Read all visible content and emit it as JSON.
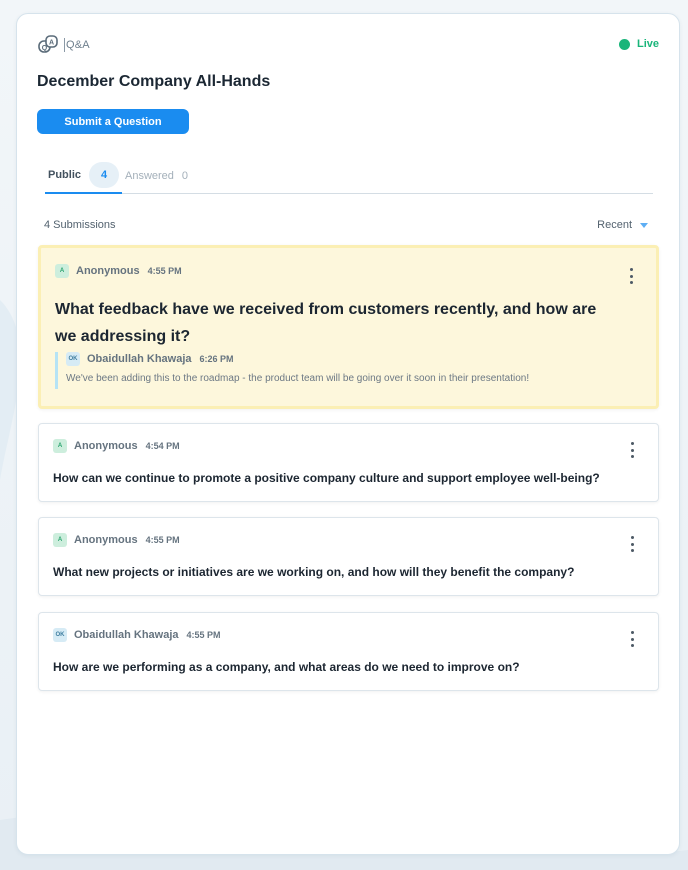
{
  "header": {
    "brand_label": "Q&A",
    "brand_icon": "qa-bubbles-icon",
    "live_label": "Live",
    "live_color": "#19b57a"
  },
  "event": {
    "title": "December Company All-Hands"
  },
  "actions": {
    "submit_label": "Submit a Question"
  },
  "tabs": [
    {
      "label": "Public",
      "count": "4",
      "active": true
    },
    {
      "label": "Answered",
      "count": "0",
      "active": false
    }
  ],
  "list": {
    "submissions_label": "4 Submissions",
    "sort_label": "Recent"
  },
  "questions": [
    {
      "author": "Anonymous",
      "initials": "A",
      "time": "4:55 PM",
      "text": "What feedback have we received from customers recently, and how are we addressing it?",
      "highlighted": true,
      "reply": {
        "author": "Obaidullah Khawaja",
        "initials": "OK",
        "time": "6:26 PM",
        "text": "We've been adding this to the roadmap - the product team will be going over it soon in their presentation!"
      }
    },
    {
      "author": "Anonymous",
      "initials": "A",
      "time": "4:54 PM",
      "text": "How can we continue to promote a positive company culture and support employee well-being?"
    },
    {
      "author": "Anonymous",
      "initials": "A",
      "time": "4:55 PM",
      "text": "What new projects or initiatives are we working on, and how will they benefit the company?"
    },
    {
      "author": "Obaidullah Khawaja",
      "initials": "OK",
      "time": "4:55 PM",
      "text": "How are we performing as a company, and what areas do we need to improve on?"
    }
  ],
  "colors": {
    "accent": "#1a8cf0",
    "highlight_bg": "#fdf7dc",
    "highlight_border": "#fbefb4"
  }
}
